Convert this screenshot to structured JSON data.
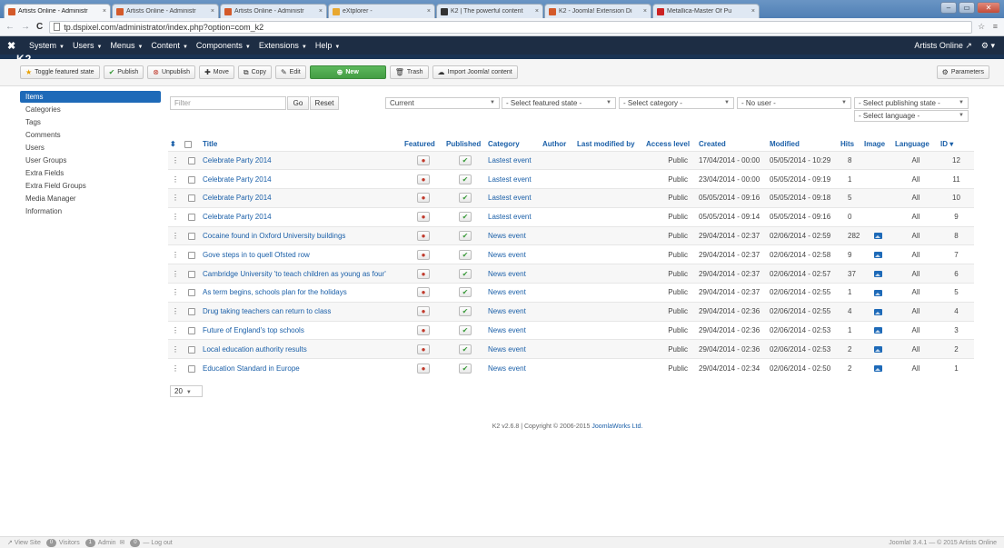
{
  "browser": {
    "tabs": [
      {
        "label": "Artists Online - Administr",
        "color": "#d45a2a"
      },
      {
        "label": "Artists Online - Administr",
        "color": "#d45a2a"
      },
      {
        "label": "Artists Online - Administr",
        "color": "#d45a2a"
      },
      {
        "label": "eXtplorer -",
        "color": "#e8a830"
      },
      {
        "label": "K2 | The powerful content",
        "color": "#333333"
      },
      {
        "label": "K2 - Joomla! Extension Di",
        "color": "#d45a2a"
      },
      {
        "label": "Metallica-Master Of Pu",
        "color": "#cc2222"
      }
    ],
    "url": "tp.dspixel.com/administrator/index.php?option=com_k2"
  },
  "adminbar": {
    "menu": [
      "System",
      "Users",
      "Menus",
      "Content",
      "Components",
      "Extensions",
      "Help"
    ],
    "site_name": "Artists Online"
  },
  "toolbar": {
    "toggle_featured": "Toggle featured state",
    "publish": "Publish",
    "unpublish": "Unpublish",
    "move": "Move",
    "copy": "Copy",
    "edit": "Edit",
    "new": "New",
    "trash": "Trash",
    "import": "Import Joomla! content",
    "parameters": "Parameters"
  },
  "sidebar": {
    "items": [
      "Items",
      "Categories",
      "Tags",
      "Comments",
      "Users",
      "User Groups",
      "Extra Fields",
      "Extra Field Groups",
      "Media Manager",
      "Information"
    ]
  },
  "filters": {
    "search_placeholder": "Filter",
    "go": "Go",
    "reset": "Reset",
    "current": "Current",
    "featured": "- Select featured state -",
    "category": "- Select category -",
    "user": "- No user -",
    "publishing": "- Select publishing state -",
    "language": "- Select language -"
  },
  "table": {
    "headers": {
      "title": "Title",
      "featured": "Featured",
      "published": "Published",
      "category": "Category",
      "author": "Author",
      "last_modified_by": "Last modified by",
      "access": "Access level",
      "created": "Created",
      "modified": "Modified",
      "hits": "Hits",
      "image": "Image",
      "language": "Language",
      "id": "ID"
    },
    "rows": [
      {
        "title": "Celebrate Party 2014",
        "category": "Lastest event",
        "access": "Public",
        "created": "17/04/2014 - 00:00",
        "modified": "05/05/2014 - 10:29",
        "hits": "8",
        "image": false,
        "language": "All",
        "id": "12"
      },
      {
        "title": "Celebrate Party 2014",
        "category": "Lastest event",
        "access": "Public",
        "created": "23/04/2014 - 00:00",
        "modified": "05/05/2014 - 09:19",
        "hits": "1",
        "image": false,
        "language": "All",
        "id": "11"
      },
      {
        "title": "Celebrate Party 2014",
        "category": "Lastest event",
        "access": "Public",
        "created": "05/05/2014 - 09:16",
        "modified": "05/05/2014 - 09:18",
        "hits": "5",
        "image": false,
        "language": "All",
        "id": "10"
      },
      {
        "title": "Celebrate Party 2014",
        "category": "Lastest event",
        "access": "Public",
        "created": "05/05/2014 - 09:14",
        "modified": "05/05/2014 - 09:16",
        "hits": "0",
        "image": false,
        "language": "All",
        "id": "9"
      },
      {
        "title": "Cocaine found in Oxford University buildings",
        "category": "News event",
        "access": "Public",
        "created": "29/04/2014 - 02:37",
        "modified": "02/06/2014 - 02:59",
        "hits": "282",
        "image": true,
        "language": "All",
        "id": "8"
      },
      {
        "title": "Gove steps in to quell Ofsted row",
        "category": "News event",
        "access": "Public",
        "created": "29/04/2014 - 02:37",
        "modified": "02/06/2014 - 02:58",
        "hits": "9",
        "image": true,
        "language": "All",
        "id": "7"
      },
      {
        "title": "Cambridge University 'to teach children as young as four'",
        "category": "News event",
        "access": "Public",
        "created": "29/04/2014 - 02:37",
        "modified": "02/06/2014 - 02:57",
        "hits": "37",
        "image": true,
        "language": "All",
        "id": "6"
      },
      {
        "title": "As term begins, schools plan for the holidays",
        "category": "News event",
        "access": "Public",
        "created": "29/04/2014 - 02:37",
        "modified": "02/06/2014 - 02:55",
        "hits": "1",
        "image": true,
        "language": "All",
        "id": "5"
      },
      {
        "title": "Drug taking teachers can return to class",
        "category": "News event",
        "access": "Public",
        "created": "29/04/2014 - 02:36",
        "modified": "02/06/2014 - 02:55",
        "hits": "4",
        "image": true,
        "language": "All",
        "id": "4"
      },
      {
        "title": "Future of England's top schools",
        "category": "News event",
        "access": "Public",
        "created": "29/04/2014 - 02:36",
        "modified": "02/06/2014 - 02:53",
        "hits": "1",
        "image": true,
        "language": "All",
        "id": "3"
      },
      {
        "title": "Local education authority results",
        "category": "News event",
        "access": "Public",
        "created": "29/04/2014 - 02:36",
        "modified": "02/06/2014 - 02:53",
        "hits": "2",
        "image": true,
        "language": "All",
        "id": "2"
      },
      {
        "title": "Education Standard in Europe",
        "category": "News event",
        "access": "Public",
        "created": "29/04/2014 - 02:34",
        "modified": "02/06/2014 - 02:50",
        "hits": "2",
        "image": true,
        "language": "All",
        "id": "1"
      }
    ]
  },
  "pager": {
    "limit": "20"
  },
  "footer": {
    "text": "K2 v2.6.8 | Copyright © 2006-2015",
    "link": "JoomlaWorks Ltd."
  },
  "statusbar": {
    "view_site": "View Site",
    "visitors_count": "0",
    "visitors": "Visitors",
    "admin_count": "1",
    "admin": "Admin",
    "messages_count": "0",
    "logout": "Log out",
    "version": "Joomla! 3.4.1 — © 2015 Artists Online"
  }
}
